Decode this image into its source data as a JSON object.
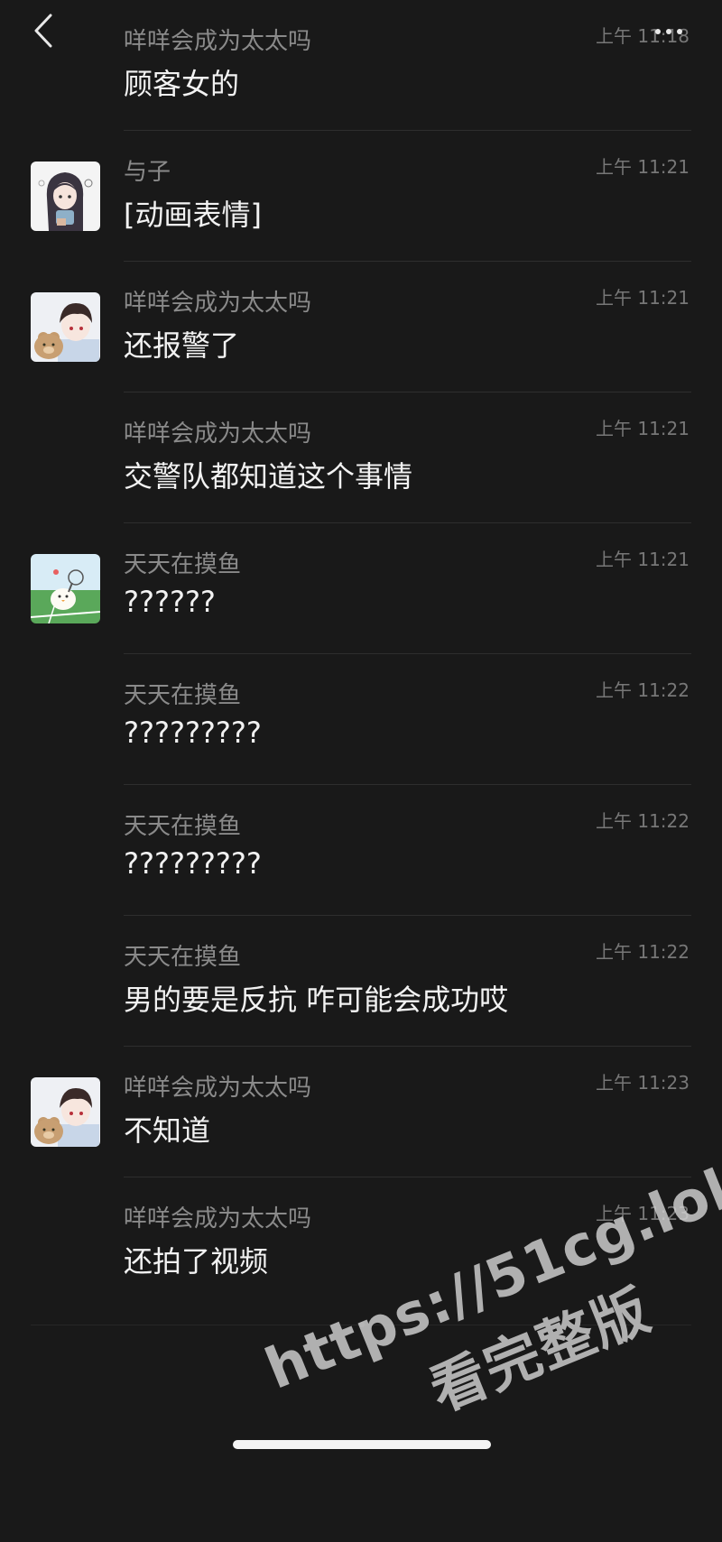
{
  "header": {
    "back_icon": "chevron-left-icon",
    "more_icon": "more-dots-icon"
  },
  "messages": [
    {
      "sender": "咩咩会成为太太吗",
      "time": "上午 11:18",
      "text": "顾客女的",
      "avatar": null
    },
    {
      "sender": "与子",
      "time": "上午 11:21",
      "text": "[动画表情]",
      "avatar": "avatar-anime-girl"
    },
    {
      "sender": "咩咩会成为太太吗",
      "time": "上午 11:21",
      "text": "还报警了",
      "avatar": "avatar-anime-boy-bear"
    },
    {
      "sender": "咩咩会成为太太吗",
      "time": "上午 11:21",
      "text": "交警队都知道这个事情",
      "avatar": null
    },
    {
      "sender": "天天在摸鱼",
      "time": "上午 11:21",
      "text": "??????",
      "avatar": "avatar-chick-tennis"
    },
    {
      "sender": "天天在摸鱼",
      "time": "上午 11:22",
      "text": "?????????",
      "avatar": null
    },
    {
      "sender": "天天在摸鱼",
      "time": "上午 11:22",
      "text": "?????????",
      "avatar": null
    },
    {
      "sender": "天天在摸鱼",
      "time": "上午 11:22",
      "text": "男的要是反抗  咋可能会成功哎",
      "avatar": null
    },
    {
      "sender": "咩咩会成为太太吗",
      "time": "上午 11:23",
      "text": "不知道",
      "avatar": "avatar-anime-boy-bear"
    },
    {
      "sender": "咩咩会成为太太吗",
      "time": "上午 11:23",
      "text": "还拍了视频",
      "avatar": null
    }
  ],
  "watermark": {
    "line1": "https://51cg.lol",
    "line2": "看完整版"
  }
}
